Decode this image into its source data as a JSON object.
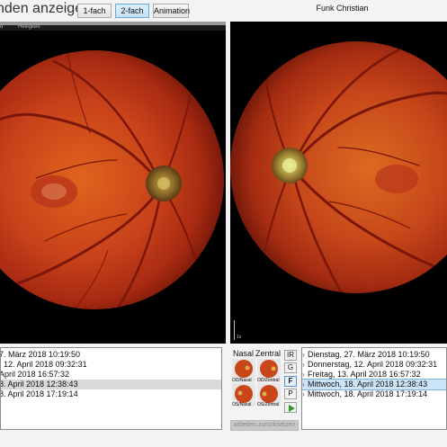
{
  "toolbar": {
    "title": "nden anzeigen",
    "btn_1fach": "1-fach",
    "btn_2fach": "2-fach",
    "btn_animation": "Animation",
    "patient_name": "Funk Christian"
  },
  "left_pane": {
    "header_text": "d          Helligkeit"
  },
  "scale_label": "1x",
  "left_list": {
    "rows": [
      "7. März 2018 10:19:50",
      ". 12. April 2018 09:32:31",
      " April 2018 16:57:32",
      "8. April 2018 12:38:43",
      "8. April 2018 17:19:14"
    ],
    "selected_index": 3
  },
  "right_list": {
    "rows": [
      "Dienstag, 27. März 2018 10:19:50",
      "Donnerstag, 12. April 2018 09:32:31",
      "Freitag, 13. April 2018 16:57:32",
      "Mittwoch, 18. April 2018 12:38:43",
      "Mittwoch, 18. April 2018 17:19:14"
    ],
    "selected_index": 3
  },
  "thumbnails": {
    "col_nasal": "Nasal",
    "col_zentral": "Zentral",
    "items": [
      "OD/Nasal",
      "OD/Zentral",
      "OS/Nasal",
      "OS/Zentral"
    ]
  },
  "modes": {
    "ir": "IR",
    "g": "G",
    "f": "F",
    "p": "P",
    "active": "F"
  },
  "bottom_button": "arbeiten zurücksetzen",
  "colors": {
    "selection_blue": "#cce4f7",
    "play_green": "#2e9d2e",
    "fundus_red": "#c0401a"
  }
}
